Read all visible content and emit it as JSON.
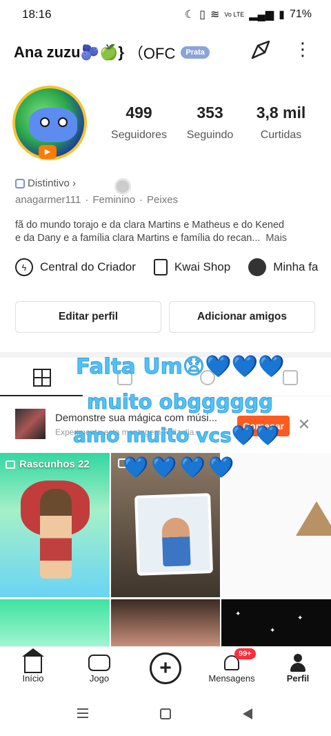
{
  "status_bar": {
    "time": "18:16",
    "battery": "71%",
    "network": "Vo LTE"
  },
  "header": {
    "title": "Ana zuzu🫐🍏}",
    "title_suffix": "（OFC",
    "badge": "Prata"
  },
  "stats": [
    {
      "value": "499",
      "label": "Seguidores"
    },
    {
      "value": "353",
      "label": "Seguindo"
    },
    {
      "value": "3,8 mil",
      "label": "Curtidas"
    }
  ],
  "profile": {
    "distintivo": "Distintivo ›",
    "username": "anagarmer111",
    "gender": "Feminino",
    "sign": "Peixes",
    "bio_line1": "fã do mundo torajo e da clara Martins e Matheus e do Kened",
    "bio_line2": "e da Dany e a família clara Martins e família do recan...",
    "bio_more": "Mais"
  },
  "quick_links": [
    {
      "label": "Central do Criador",
      "icon": "lightning-icon"
    },
    {
      "label": "Kwai Shop",
      "icon": "shopping-bag-icon"
    },
    {
      "label": "Minha fa",
      "icon": "avatar-icon"
    }
  ],
  "buttons": {
    "edit": "Editar perfil",
    "add": "Adicionar amigos"
  },
  "overlay": {
    "line1": "Falta Um😧💙💙💙",
    "line2": "muito obgggggg",
    "line3": "amo muito vcs💙💙",
    "line4": "💙💙💙💙"
  },
  "promo": {
    "title": "Demonstre sua mágica com músi...",
    "subtitle": "Experimente esta montagem Feliz dia...",
    "cta": "Começar"
  },
  "grid": {
    "drafts_label": "Rascunhos 22"
  },
  "bottom_nav": {
    "inicio": "Início",
    "jogo": "Jogo",
    "mensagens": "Mensagens",
    "perfil": "Perfil",
    "badge": "99+"
  }
}
